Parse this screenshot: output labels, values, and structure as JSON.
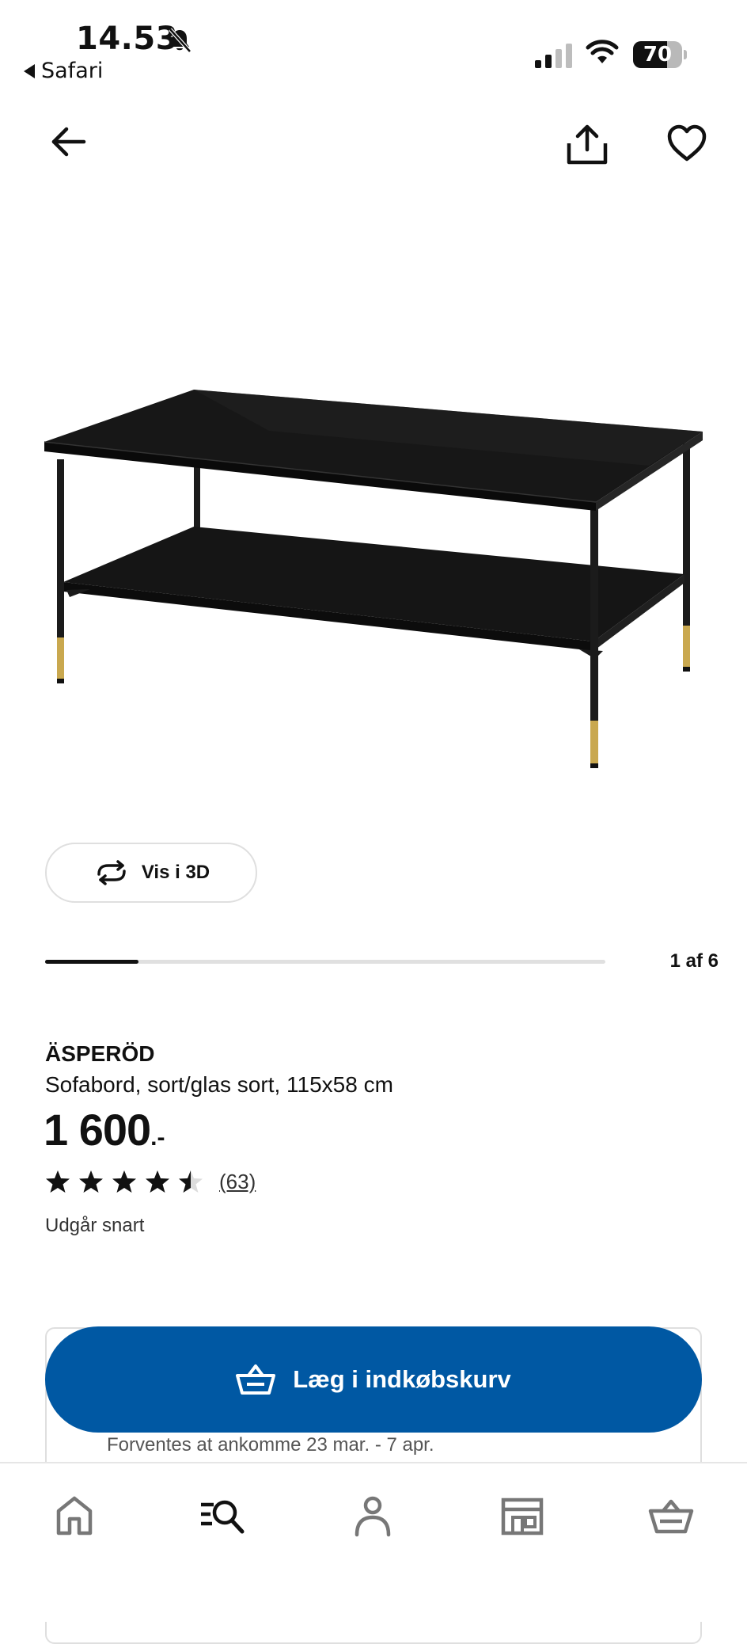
{
  "status_bar": {
    "time": "14.53",
    "back_app_label": "Safari",
    "battery_percent": 70
  },
  "nav": {
    "back_icon": "arrow-left-icon",
    "share_icon": "share-icon",
    "favorite_icon": "heart-icon"
  },
  "media": {
    "view_3d_label": "Vis i 3D",
    "gallery_position": "1 af 6",
    "gallery_progress_fraction": 0.1667
  },
  "product": {
    "name": "ÄSPERÖD",
    "description": "Sofabord, sort/glas sort, 115x58 cm",
    "price": "1 600",
    "price_suffix": ".-",
    "rating": 4.5,
    "rating_max": 5,
    "review_count": "(63)",
    "availability": "Udgår snart"
  },
  "purchase": {
    "add_to_cart_label": "Læg i indkøbskurv",
    "delivery_text": "Forventes at ankomme 23 mar. - 7 apr."
  },
  "tab_bar": {
    "items": [
      "home-icon",
      "search-list-icon",
      "profile-icon",
      "store-icon",
      "cart-icon"
    ],
    "active_index": 1
  },
  "colors": {
    "primary_button": "#0058a3",
    "text": "#111111",
    "progress_track": "#e0e0e0",
    "brass": "#c9a84f"
  }
}
